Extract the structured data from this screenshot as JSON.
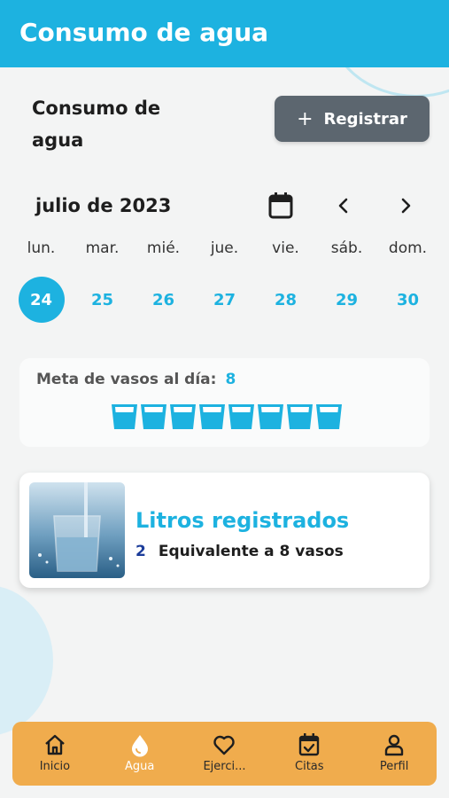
{
  "app_bar": {
    "title": "Consumo de agua"
  },
  "header": {
    "title": "Consumo de agua",
    "register_label": "Registrar",
    "register_icon": "plus-icon"
  },
  "calendar": {
    "month": "julio de 2023",
    "weekdays": [
      "lun.",
      "mar.",
      "mié.",
      "jue.",
      "vie.",
      "sáb.",
      "dom."
    ],
    "days": [
      "24",
      "25",
      "26",
      "27",
      "28",
      "29",
      "30"
    ],
    "selected_day": "24"
  },
  "goal": {
    "label": "Meta de vasos al día:",
    "value": "8",
    "glasses_count": 8
  },
  "liters": {
    "title": "Litros registrados",
    "value": "2",
    "equivalent": "Equivalente a 8 vasos"
  },
  "nav": {
    "items": [
      {
        "label": "Inicio",
        "icon": "home-icon"
      },
      {
        "label": "Agua",
        "icon": "water-drop-icon",
        "active": true
      },
      {
        "label": "Ejerci...",
        "icon": "heart-icon"
      },
      {
        "label": "Citas",
        "icon": "calendar-check-icon"
      },
      {
        "label": "Perfil",
        "icon": "person-icon"
      }
    ]
  },
  "colors": {
    "primary": "#1db2e0",
    "button": "#5c666f",
    "nav_bg": "#f0ac4d",
    "liters_value": "#1c3d9a"
  }
}
